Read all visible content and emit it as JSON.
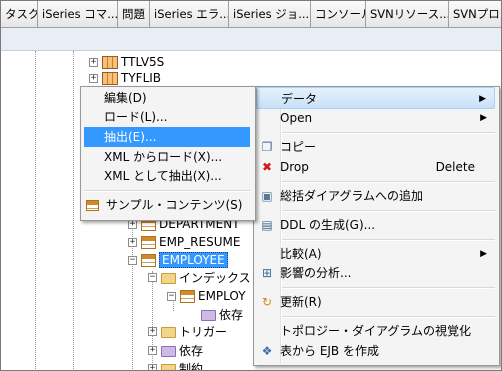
{
  "tabs": [
    "タスク",
    "iSeries コマ...",
    "問題",
    "iSeries エラ...",
    "iSeries ジョ...",
    "コンソール",
    "SVNリソース...",
    "SVNプロ..."
  ],
  "tree": {
    "ttlv5s": "TTLV5S",
    "tyflib": "TYFLIB",
    "department": "DEPARTMENT",
    "emp_resume": "EMP_RESUME",
    "employee": "EMPLOYEE",
    "index_folder": "インデックス",
    "employ_index": "EMPLOY",
    "dependency": "依存",
    "trigger_folder": "トリガー",
    "dependency_folder": "依存",
    "constraint_folder": "制約"
  },
  "context_menu": {
    "data": "データ",
    "open": "Open",
    "copy": "コピー",
    "drop": "Drop",
    "drop_shortcut": "Delete",
    "add_to_diagram": "総括ダイアグラムへの追加",
    "generate_ddl": "DDL の生成(G)...",
    "compare": "比較(A)",
    "impact_analysis": "影響の分析...",
    "refresh": "更新(R)",
    "topology_visualize": "トポロジー・ダイアグラムの視覚化",
    "table_to_ejb": "表から EJB を作成"
  },
  "data_submenu": {
    "edit": "編集(D)",
    "load": "ロード(L)...",
    "extract": "抽出(E)...",
    "load_xml": "XML からロード(X)...",
    "extract_xml": "XML として抽出(X)...",
    "sample_contents": "サンプル・コンテンツ(S)"
  },
  "colors": {
    "selection": "#3399ff",
    "menu_bg": "#f4f4f4"
  }
}
